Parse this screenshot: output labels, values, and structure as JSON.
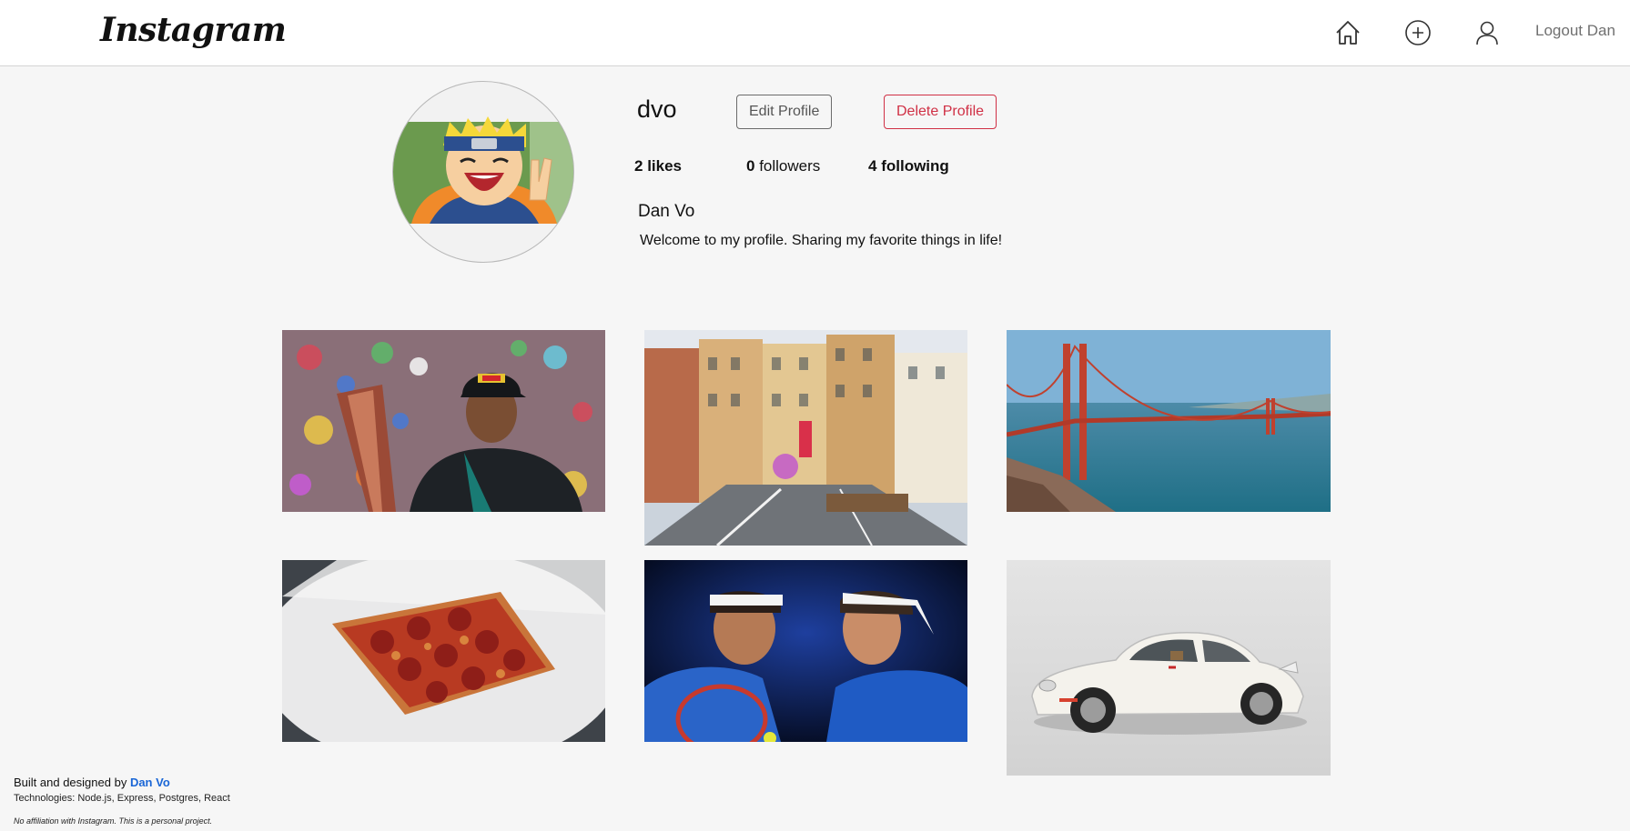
{
  "navbar": {
    "logo_text": "Instagram",
    "icons": [
      "home-icon",
      "add-post-icon",
      "user-icon"
    ],
    "logout_label": "Logout Dan"
  },
  "profile": {
    "username": "dvo",
    "edit_label": "Edit Profile",
    "delete_label": "Delete Profile",
    "likes_count": "2",
    "likes_label": "likes",
    "followers_count": "0",
    "followers_label": "followers",
    "following_count": "4",
    "following_label": "following",
    "full_name": "Dan Vo",
    "bio": "Welcome to my profile. Sharing my favorite things in life!"
  },
  "posts": [
    {
      "subject": "racing-driver-trophy"
    },
    {
      "subject": "city-street"
    },
    {
      "subject": "golden-gate-bridge"
    },
    {
      "subject": "pepperoni-pizza"
    },
    {
      "subject": "tennis-players"
    },
    {
      "subject": "white-sports-car"
    }
  ],
  "footer": {
    "built_prefix": "Built and designed by",
    "author_link": "Dan Vo",
    "technologies": "Technologies: Node.js, Express, Postgres, React",
    "disclaimer": "No affiliation with Instagram. This is a personal project."
  },
  "colors": {
    "background": "#f6f6f6",
    "navbar": "#ffffff",
    "delete_accent": "#d03045",
    "link": "#1a66d6"
  }
}
